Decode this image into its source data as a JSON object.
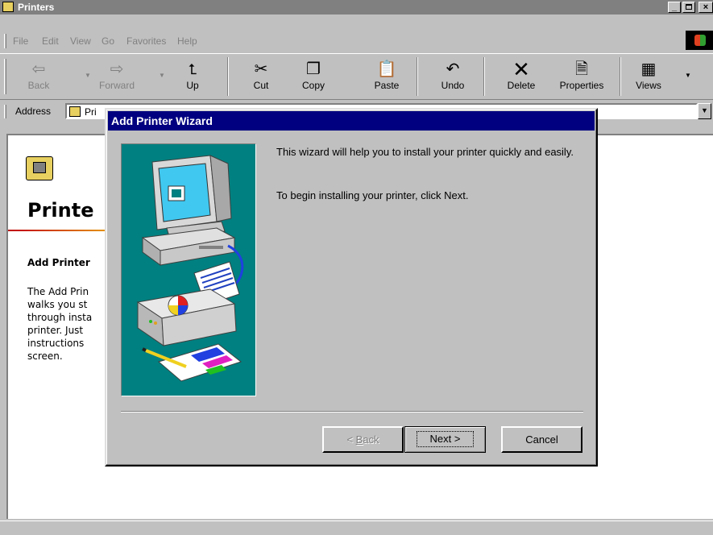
{
  "window": {
    "title": "Printers",
    "minimize": "_",
    "maximize": "▫",
    "close": "×"
  },
  "menu": [
    {
      "key": "F",
      "rest": "ile"
    },
    {
      "key": "E",
      "rest": "dit"
    },
    {
      "key": "V",
      "rest": "iew"
    },
    {
      "key": "G",
      "rest": "o"
    },
    {
      "key": "F",
      "rest": "avorites",
      "pre": "F",
      "label": "Favorites"
    },
    {
      "key": "H",
      "rest": "elp"
    }
  ],
  "menu_labels": {
    "file": "File",
    "edit": "Edit",
    "view": "View",
    "go": "Go",
    "favorites": "Favorites",
    "help": "Help"
  },
  "toolbar": {
    "back": "Back",
    "forward": "Forward",
    "up": "Up",
    "cut": "Cut",
    "copy": "Copy",
    "paste": "Paste",
    "undo": "Undo",
    "delete": "Delete",
    "properties": "Properties",
    "views": "Views"
  },
  "address": {
    "label": "Address",
    "value": "Pri"
  },
  "content": {
    "title": "Printe",
    "subtitle": "Add Printer",
    "body": [
      "The Add Prin",
      "walks you st",
      "through insta",
      "printer. Just",
      "instructions",
      "screen."
    ]
  },
  "dialog": {
    "title": "Add Printer Wizard",
    "text1": "This wizard will help you to install your printer quickly and easily.",
    "text2": "To begin installing your printer, click Next.",
    "back_key": "B",
    "back_rest": "ack",
    "back_prefix": "< ",
    "next_label": "Next >",
    "cancel_label": "Cancel"
  },
  "colors": {
    "dialog_titlebar": "#000080",
    "wizard_panel": "#008080",
    "window_titlebar_inactive": "#808080"
  },
  "icons": [
    "printers-folder-icon",
    "back-arrow-icon",
    "forward-arrow-icon",
    "up-folder-icon",
    "cut-scissors-icon",
    "copy-icon",
    "paste-icon",
    "undo-icon",
    "delete-x-icon",
    "properties-icon",
    "views-icon",
    "windows-logo-icon",
    "computer-printer-illustration"
  ]
}
